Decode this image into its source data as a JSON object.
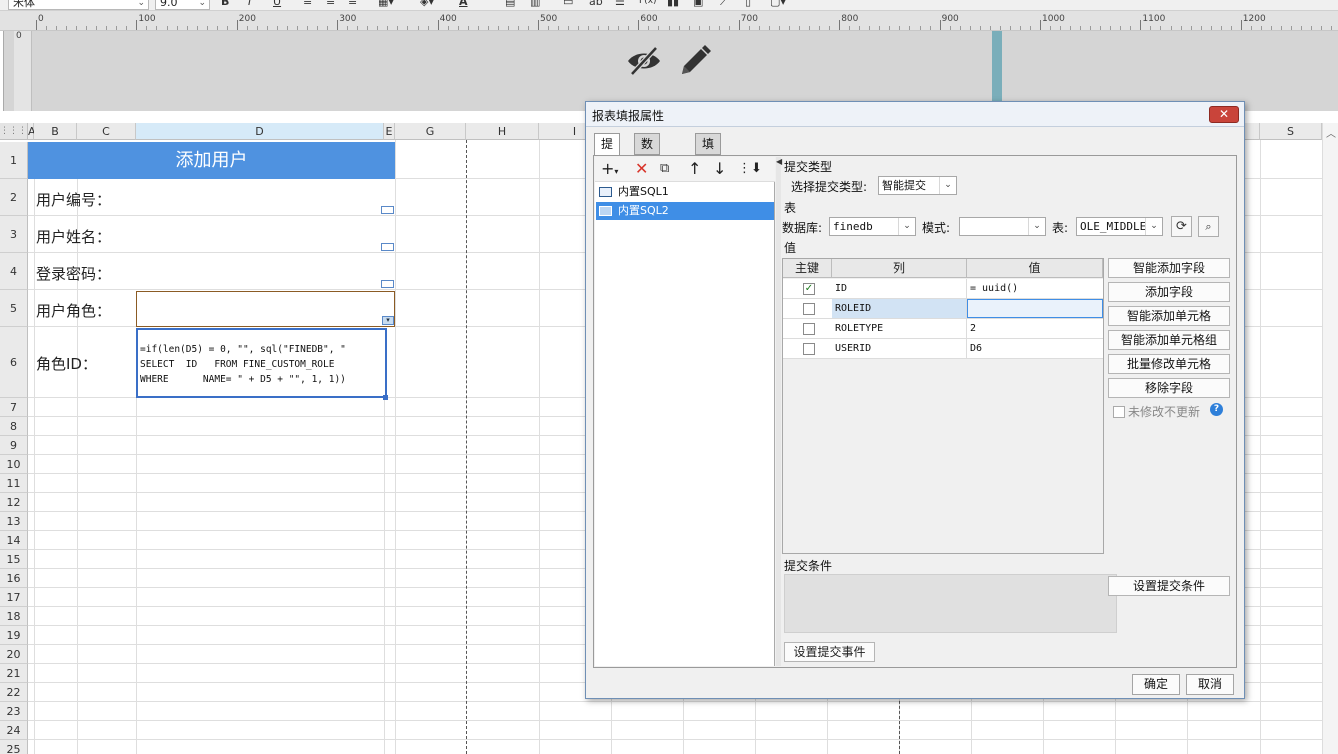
{
  "toolbar": {
    "font_name": "宋体",
    "font_size": "9.0",
    "bold": "B",
    "italic": "I",
    "underline": "U",
    "font_color": "A",
    "formula": "F(x)",
    "text_glyph": "ab"
  },
  "ruler": {
    "labels": [
      "0",
      "100",
      "200",
      "300",
      "400",
      "500",
      "600",
      "700",
      "800",
      "900",
      "1000",
      "1100",
      "1200"
    ],
    "vertical_label": "0"
  },
  "header_band": {
    "hide_icon": "eye-slash-icon",
    "edit_icon": "pencil-icon",
    "marker_color": "#7aaeba"
  },
  "grid": {
    "columns": [
      "A",
      "B",
      "C",
      "D",
      "E",
      "G",
      "H",
      "I",
      "S"
    ],
    "rows": [
      "1",
      "2",
      "3",
      "4",
      "5",
      "6",
      "7",
      "8",
      "9",
      "10",
      "11",
      "12",
      "13",
      "14",
      "15",
      "16",
      "17",
      "18",
      "19",
      "20",
      "21",
      "22",
      "23",
      "24",
      "25"
    ],
    "title": "添加用户",
    "title_color": "#4f92e0",
    "labels": {
      "user_no": "用户编号：",
      "user_name": "用户姓名：",
      "password": "登录密码：",
      "user_role": "用户角色：",
      "role_id": "角色ID："
    },
    "formula_text": "=if(len(D5) = 0, \"\", sql(\"FINEDB\", \"\nSELECT  ID   FROM FINE_CUSTOM_ROLE\nWHERE      NAME= \" + D5 + \"\", 1, 1))"
  },
  "dialog": {
    "title": "报表填报属性",
    "close": "✕",
    "tabs": [
      "提交",
      "数据校验",
      "填报快捷键设置"
    ],
    "sql_items": [
      "内置SQL1",
      "内置SQL2"
    ],
    "submit_type_section": "提交类型",
    "submit_type_label": "选择提交类型:",
    "submit_type_value": "智能提交",
    "table_section": "表",
    "db_label": "数据库:",
    "db_value": "finedb",
    "schema_label": "模式:",
    "schema_value": "",
    "table_label": "表:",
    "table_value": "OLE_MIDDLE",
    "value_section": "值",
    "columns": {
      "key": "主键",
      "col": "列",
      "val": "值"
    },
    "rows": [
      {
        "key": true,
        "col": "ID",
        "val": "= uuid()"
      },
      {
        "key": false,
        "col": "ROLEID",
        "val": ""
      },
      {
        "key": false,
        "col": "ROLETYPE",
        "val": "2"
      },
      {
        "key": false,
        "col": "USERID",
        "val": "D6"
      }
    ],
    "side_buttons": [
      "智能添加字段",
      "添加字段",
      "智能添加单元格",
      "智能添加单元格组",
      "批量修改单元格",
      "移除字段"
    ],
    "no_change_label": "未修改不更新",
    "help": "?",
    "condition_section": "提交条件",
    "condition_button": "设置提交条件",
    "event_button": "设置提交事件",
    "ok": "确定",
    "cancel": "取消"
  }
}
